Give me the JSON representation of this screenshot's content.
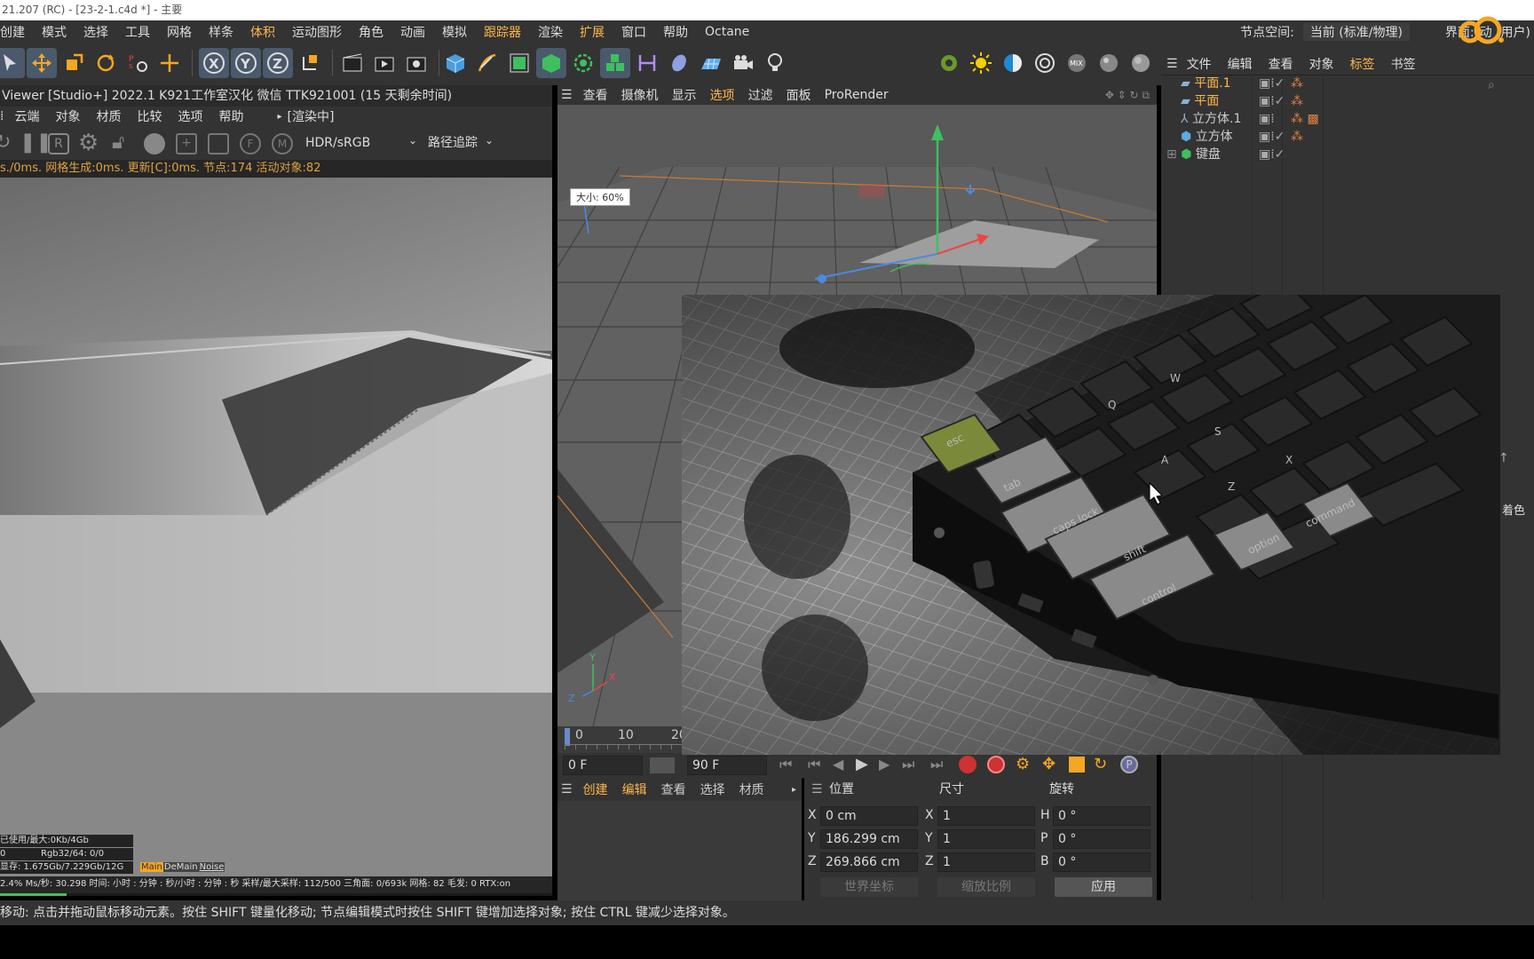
{
  "window": {
    "title": "21.207 (RC) - [23-2-1.c4d *] - 主要"
  },
  "menubar": {
    "items": [
      "创建",
      "模式",
      "选择",
      "工具",
      "网格",
      "样条",
      "体积",
      "运动图形",
      "角色",
      "动画",
      "模拟",
      "跟踪器",
      "渲染",
      "扩展",
      "窗口",
      "帮助",
      "Octane"
    ],
    "highlighted": [
      "体积",
      "跟踪器",
      "扩展"
    ],
    "node_space_label": "节点空间:",
    "node_space_value": "当前 (标准/物理)",
    "interface_label": "界面:",
    "interface_value": "动 (用户)"
  },
  "render_viewer": {
    "title": "Viewer [Studio+] 2022.1  K921工作室汉化  微信  TTK921001 (15 天剩余时间)",
    "menu": [
      "云端",
      "对象",
      "材质",
      "比较",
      "选项",
      "帮助"
    ],
    "rendering_label": "[渲染中]",
    "colorspace": "HDR/sRGB",
    "mode": "路径追踪",
    "stats_line": "s./0ms. 网格生成:0ms. 更新[C]:0ms. 节点:174 活动对象:82",
    "footer": {
      "mem": "已使用/最大:0Kb/4Gb",
      "rgb_left": "0",
      "rgb": "Rgb32/64: 0/0",
      "vram": "显存: 1.675Gb/7.229Gb/12G",
      "tabs": [
        "Main",
        "DeMain",
        "Noise"
      ],
      "progress_line": "2.4%  Ms/秒: 30.298   时间: 小时 : 分钟 : 秒/小时 : 分钟 : 秒    采样/最大采样: 112/500     三角面: 0/693k    网格: 82     毛发: 0    RTX:on",
      "progress_pct": 2.4
    }
  },
  "viewport": {
    "menu": [
      "查看",
      "摄像机",
      "显示",
      "选项",
      "过滤",
      "面板",
      "ProRender"
    ],
    "size_label": "大小: 60%"
  },
  "timeline": {
    "ticks": [
      "0",
      "10",
      "20"
    ],
    "start_frame": "0 F",
    "end_frame": "90 F"
  },
  "material_panel": {
    "menu": [
      "创建",
      "编辑",
      "查看",
      "选择",
      "材质"
    ]
  },
  "coordinates": {
    "headers": {
      "position": "位置",
      "size": "尺寸",
      "rotation": "旋转"
    },
    "rows": [
      {
        "axis": "X",
        "pos": "0 cm",
        "size_axis": "X",
        "size": "1",
        "rot_axis": "H",
        "rot": "0 °"
      },
      {
        "axis": "Y",
        "pos": "186.299 cm",
        "size_axis": "Y",
        "size": "1",
        "rot_axis": "P",
        "rot": "0 °"
      },
      {
        "axis": "Z",
        "pos": "269.866 cm",
        "size_axis": "Z",
        "size": "1",
        "rot_axis": "B",
        "rot": "0 °"
      }
    ],
    "world_coords": "世界坐标",
    "scale": "缩放比例",
    "apply": "应用"
  },
  "object_manager": {
    "menu": [
      "文件",
      "编辑",
      "查看",
      "对象",
      "标签",
      "书签"
    ],
    "objects": [
      {
        "name": "平面.1",
        "color": "#ffb64a"
      },
      {
        "name": "平面",
        "color": "#ffb64a"
      },
      {
        "name": "立方体.1",
        "color": "#dddddd"
      },
      {
        "name": "立方体",
        "color": "#dddddd"
      },
      {
        "name": "键盘",
        "color": "#dddddd"
      }
    ],
    "side_text": "着色"
  },
  "overlay_keys": [
    "esc",
    "tab",
    "caps lock",
    "shift",
    "control",
    "option",
    "command",
    "Q",
    "W",
    "A",
    "S",
    "Z",
    "X"
  ],
  "statusbar": {
    "text": "移动: 点击并拖动鼠标移动元素。按住 SHIFT 键量化移动; 节点编辑模式时按住 SHIFT 键增加选择对象; 按住 CTRL 键减少选择对象。"
  },
  "colors": {
    "accent": "#ffb64a",
    "panel": "#333333",
    "selected": "#4a5a6c"
  }
}
